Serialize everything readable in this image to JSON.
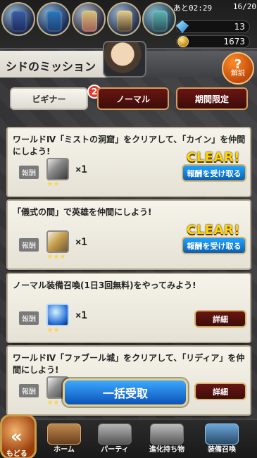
{
  "header": {
    "timer_label": "あと02:29",
    "stamina": "16/20",
    "gems": "13",
    "gil": "1673"
  },
  "title": {
    "text": "シドのミッション",
    "help_label": "解説"
  },
  "tabs": [
    {
      "label": "ビギナー",
      "badge": "2"
    },
    {
      "label": "ノーマル"
    },
    {
      "label": "期間限定"
    }
  ],
  "missions": [
    {
      "text": "ワールドⅣ「ミストの洞窟」をクリアして、「カイン」を仲間にしよう!",
      "reward_label": "報酬",
      "quantity": "×1",
      "clear_label": "CLEAR!",
      "action_label": "報酬を受け取る"
    },
    {
      "text": "「儀式の間」で英雄を仲間にしよう!",
      "reward_label": "報酬",
      "quantity": "×1",
      "clear_label": "CLEAR!",
      "action_label": "報酬を受け取る"
    },
    {
      "text": "ノーマル装備召喚(1日3回無料)をやってみよう!",
      "reward_label": "報酬",
      "quantity": "×1",
      "action_label": "詳細"
    },
    {
      "text": "ワールドⅣ「ファブール城」をクリアして、「リディア」を仲間にしよう!",
      "reward_label": "報酬",
      "action_label": "詳細"
    }
  ],
  "bulk_receive_label": "一括受取",
  "bottom_nav": {
    "back_label": "もどる",
    "items": [
      {
        "label": "ホーム"
      },
      {
        "label": "パーティ"
      },
      {
        "label": "進化持ち物"
      },
      {
        "label": "装備召喚"
      }
    ]
  }
}
